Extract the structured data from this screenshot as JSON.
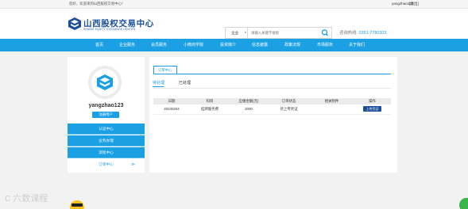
{
  "topbar": {
    "welcome": "您好，欢迎来到山西股权交易中心！",
    "user": "yangzhao123",
    "logout": "[退出]"
  },
  "brand": {
    "name_cn": "山西股权交易中心",
    "name_en": "SHANXI EQUITY EXCHANGE CENTER",
    "color": "#1b4f9c"
  },
  "search": {
    "category": "企业",
    "placeholder": "请输入关键字搜索",
    "icon": "search-icon"
  },
  "hotline": {
    "label": "咨询热线",
    "number": "0351-7780303"
  },
  "nav": {
    "items": [
      {
        "label": "首页"
      },
      {
        "label": "企业服务"
      },
      {
        "label": "会员服务"
      },
      {
        "label": "小微商学院"
      },
      {
        "label": "投资媒介"
      },
      {
        "label": "信息披露"
      },
      {
        "label": "政策法规"
      },
      {
        "label": "市场服务"
      },
      {
        "label": "关于我们"
      }
    ],
    "color": "#1ba0e3"
  },
  "sidebar": {
    "username": "yangzhao123",
    "register_label": "注册用户",
    "menu": [
      {
        "label": "认证中心"
      },
      {
        "label": "业务办理"
      },
      {
        "label": "流程中心"
      },
      {
        "label": "订单中心"
      }
    ],
    "arrow": "≫"
  },
  "content": {
    "title": "订单中心",
    "tabs": [
      {
        "label": "待处理"
      },
      {
        "label": "已处理"
      }
    ],
    "table": {
      "headers": [
        "日期",
        "科目",
        "应缴金额(元)",
        "订单状态",
        "相关附件",
        "操作"
      ],
      "rows": [
        {
          "date": "20230204",
          "subject": "挂牌服务费",
          "amount": "2000",
          "status": "待上传凭证",
          "attachment": "",
          "action": "上传凭证"
        }
      ]
    }
  },
  "overlay": {
    "watermark": "六数课程",
    "watermark_mark": "C"
  }
}
